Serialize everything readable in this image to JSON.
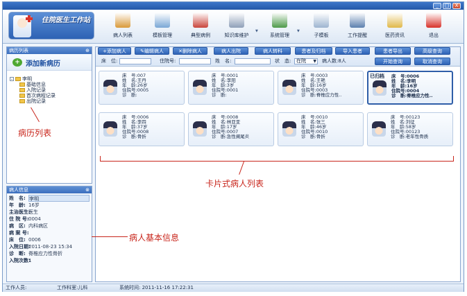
{
  "window": {
    "buttons": [
      "_",
      "□",
      "X"
    ]
  },
  "logo": {
    "title": "住院医生工作站"
  },
  "toolbar": {
    "items": [
      {
        "label": "病人列表",
        "icon": "patient-list-icon",
        "color": "#d99a3a"
      },
      {
        "label": "模板管理",
        "icon": "template-manage-icon",
        "color": "#7aa7d6"
      },
      {
        "label": "典型病例",
        "icon": "typical-case-icon",
        "color": "#c9453c"
      },
      {
        "label": "知识库维护",
        "icon": "knowledge-base-icon",
        "color": "#8e9fb8"
      },
      {
        "label": "系统管理",
        "icon": "system-manage-icon",
        "color": "#4e9a4a"
      },
      {
        "label": "子模板",
        "icon": "sub-template-icon",
        "color": "#9db4d0"
      },
      {
        "label": "工作提醒",
        "icon": "work-reminder-icon",
        "color": "#5b7fae"
      },
      {
        "label": "医药资讯",
        "icon": "medical-news-icon",
        "color": "#e0b84a"
      },
      {
        "label": "退出",
        "icon": "power-icon",
        "color": "#d8322a"
      }
    ]
  },
  "left_panel": {
    "title": "病历列表",
    "pin": "⊕",
    "add_button": "添加新病历",
    "tree": {
      "root": "李明",
      "children": [
        "基础信息",
        "入院记录",
        "首次病程记录",
        "出院记录"
      ]
    }
  },
  "info_panel": {
    "title": "病人信息",
    "pin": "⊗",
    "rows": [
      {
        "k": "姓　名:",
        "v": "李明"
      },
      {
        "k": "年　龄:",
        "v": "16岁"
      },
      {
        "k": "主治医生:",
        "v": "医生"
      },
      {
        "k": "住 院 号:",
        "v": "0004"
      },
      {
        "k": "病　区:",
        "v": "内科病区"
      },
      {
        "k": "病 案 号:",
        "v": ""
      },
      {
        "k": "床　位:",
        "v": "0006"
      },
      {
        "k": "入院日期:",
        "v": "2011-08-23 15:34"
      },
      {
        "k": "诊　断:",
        "v": "脊椎应力性骨折"
      },
      {
        "k": "入院次数:",
        "v": "1"
      }
    ]
  },
  "actions": {
    "buttons": [
      "+添加病人",
      "✎编辑病人",
      "✕删除病人",
      "病人出院",
      "病人转科",
      "患者及归档",
      "导入患者",
      "患者导出",
      "高级查询"
    ],
    "buttons2": [
      "开始查询",
      "取消查询"
    ]
  },
  "filters": {
    "bed_label": "床　位:",
    "bed_value": "",
    "admission_label": "住院号:",
    "admission_value": "",
    "name_label": "姓　名:",
    "name_value": "",
    "status_label": "状　态:",
    "status_value": "在院",
    "count_text": "病人数:8人"
  },
  "cards": [
    {
      "bed": "床　号:007",
      "name": "姓　名:王丹",
      "age": "年　龄:26岁",
      "admission": "住院号:0005",
      "diagnosis": "诊　断:",
      "selected": false,
      "corner": ""
    },
    {
      "bed": "床　号:0001",
      "name": "姓　名:李阳",
      "age": "年　龄:3岁",
      "admission": "住院号:0001",
      "diagnosis": "诊　断:",
      "selected": false,
      "corner": ""
    },
    {
      "bed": "床　号:0003",
      "name": "姓　名:王艳",
      "age": "年　龄:16岁",
      "admission": "住院号:0003",
      "diagnosis": "诊　断:脊椎应力性..",
      "selected": false,
      "corner": ""
    },
    {
      "bed": "床　号:0006",
      "name": "姓　名:李明",
      "age": "年　龄:16岁",
      "admission": "住院号:0004",
      "diagnosis": "诊　断:脊椎应力性..",
      "selected": true,
      "corner": "已归档"
    },
    {
      "bed": "床　号:0006",
      "name": "姓　名:李四",
      "age": "年　龄:37岁",
      "admission": "住院号:0008",
      "diagnosis": "诊　断:骨折",
      "selected": false,
      "corner": ""
    },
    {
      "bed": "床　号:0008",
      "name": "姓　名:林亚亚",
      "age": "年　龄:17岁",
      "admission": "住院号:0007",
      "diagnosis": "诊　断:急性阑尾炎",
      "selected": false,
      "corner": ""
    },
    {
      "bed": "床　号:0010",
      "name": "姓　名:张三",
      "age": "年　龄:46岁",
      "admission": "住院号:0010",
      "diagnosis": "诊　断:骨折",
      "selected": false,
      "corner": ""
    },
    {
      "bed": "床　号:00123",
      "name": "姓　名:刘征",
      "age": "年　龄:58岁",
      "admission": "住院号:00123",
      "diagnosis": "诊　断:老年性骨质",
      "selected": false,
      "corner": ""
    }
  ],
  "annotations": {
    "record_list": "病历列表",
    "card_list": "卡片式病人列表",
    "basic_info": "病人基本信息"
  },
  "status": {
    "staff": "工作人员:",
    "dept": "工作科室:儿科",
    "time": "系统时间: 2011-11-16 17:22:31"
  }
}
